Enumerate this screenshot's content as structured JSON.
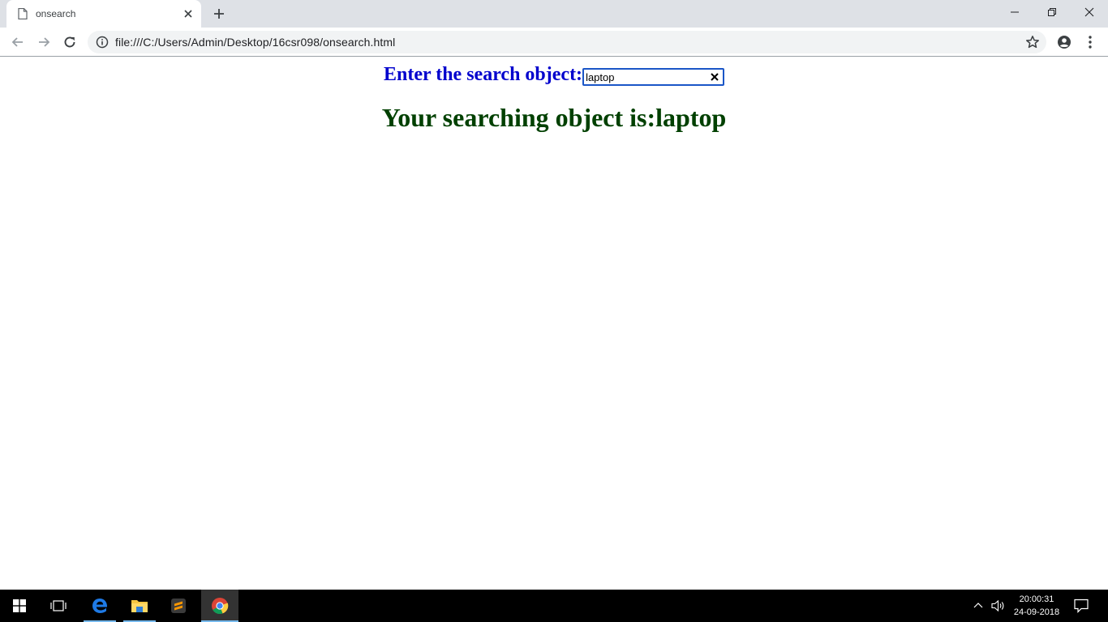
{
  "browser": {
    "tab_title": "onsearch",
    "url": "file:///C:/Users/Admin/Desktop/16csr098/onsearch.html"
  },
  "page": {
    "search_label": "Enter the search object:",
    "search_value": "laptop",
    "result_text": "Your searching object is:laptop"
  },
  "taskbar": {
    "time": "20:00:31",
    "date": "24-09-2018"
  },
  "colors": {
    "label": "#0000cd",
    "result": "#004000",
    "taskbar": "#000000"
  }
}
